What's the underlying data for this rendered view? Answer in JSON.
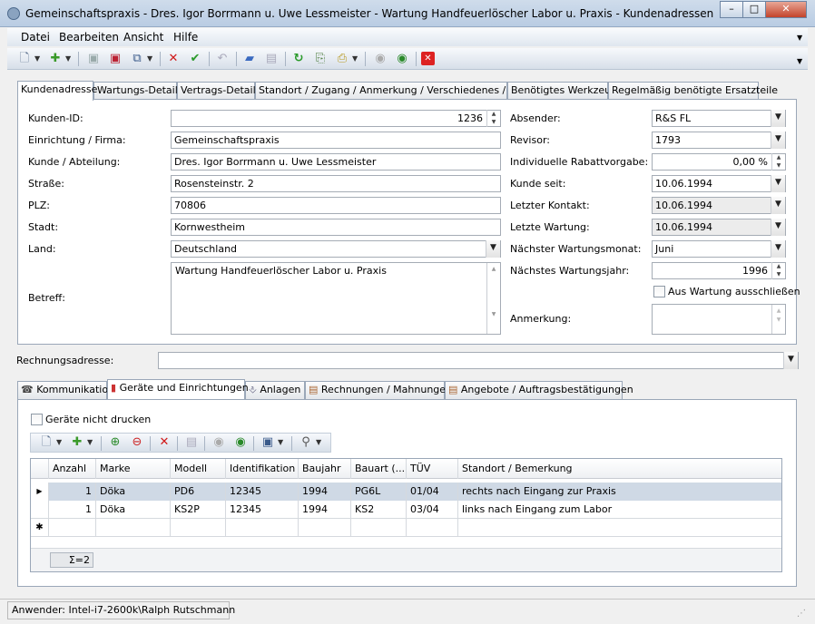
{
  "window": {
    "title": "Gemeinschaftspraxis - Dres. Igor Borrmann u. Uwe Lessmeister - Wartung Handfeuerlöscher Labor u. Praxis - Kundenadressen"
  },
  "menu": [
    "Datei",
    "Bearbeiten",
    "Ansicht",
    "Hilfe"
  ],
  "main_tabs": [
    "Kundenadresse",
    "Wartungs-Details",
    "Vertrags-Details",
    "Standort / Zugang / Anmerkung / Verschiedenes / Photo",
    "Benötigtes Werkzeug",
    "Regelmäßig benötigte Ersatzteile"
  ],
  "form_left": {
    "kunden_id": {
      "label": "Kunden-ID:",
      "value": "1236"
    },
    "einrichtung": {
      "label": "Einrichtung / Firma:",
      "value": "Gemeinschaftspraxis"
    },
    "kunde": {
      "label": "Kunde / Abteilung:",
      "value": "Dres. Igor Borrmann u. Uwe Lessmeister"
    },
    "strasse": {
      "label": "Straße:",
      "value": "Rosensteinstr. 2"
    },
    "plz": {
      "label": "PLZ:",
      "value": "70806"
    },
    "stadt": {
      "label": "Stadt:",
      "value": "Kornwestheim"
    },
    "land": {
      "label": "Land:",
      "value": "Deutschland"
    },
    "betreff": {
      "label": "Betreff:",
      "value": "Wartung Handfeuerlöscher Labor u. Praxis"
    }
  },
  "form_right": {
    "absender": {
      "label": "Absender:",
      "value": "R&S FL"
    },
    "revisor": {
      "label": "Revisor:",
      "value": "1793"
    },
    "rabatt": {
      "label": "Individuelle Rabattvorgabe:",
      "value": "0,00 %"
    },
    "kunde_seit": {
      "label": "Kunde seit:",
      "value": "10.06.1994"
    },
    "letzter_kontakt": {
      "label": "Letzter Kontakt:",
      "value": "10.06.1994"
    },
    "letzte_wartung": {
      "label": "Letzte Wartung:",
      "value": "10.06.1994"
    },
    "naechster_monat": {
      "label": "Nächster Wartungsmonat:",
      "value": "Juni"
    },
    "naechstes_jahr": {
      "label": "Nächstes Wartungsjahr:",
      "value": "1996"
    },
    "ausschliessen": {
      "label": "Aus Wartung ausschließen"
    },
    "anmerkung": {
      "label": "Anmerkung:",
      "value": ""
    }
  },
  "rechnungsadresse": {
    "label": "Rechnungsadresse:",
    "value": ""
  },
  "sub_tabs": [
    "Kommunikation",
    "Geräte und Einrichtungen",
    "Anlagen",
    "Rechnungen / Mahnungen",
    "Angebote / Auftragsbestätigungen"
  ],
  "geraete": {
    "nicht_drucken": "Geräte nicht drucken",
    "columns": [
      "Anzahl",
      "Marke",
      "Modell",
      "Identifikation",
      "Baujahr",
      "Bauart (...",
      "TÜV",
      "Standort / Bemerkung"
    ],
    "rows": [
      [
        "1",
        "Döka",
        "PD6",
        "12345",
        "1994",
        "PG6L",
        "01/04",
        "rechts nach Eingang zur Praxis"
      ],
      [
        "1",
        "Döka",
        "KS2P",
        "12345",
        "1994",
        "KS2",
        "03/04",
        "links nach Eingang zum Labor"
      ]
    ],
    "sum": "Σ=2"
  },
  "status": "Anwender: Intel-i7-2600k\\Ralph Rutschmann"
}
